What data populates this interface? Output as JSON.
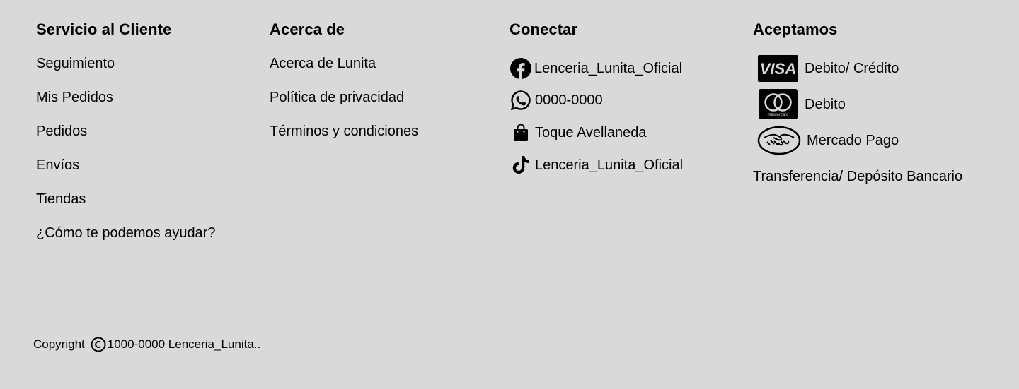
{
  "service": {
    "title": "Servicio al Cliente",
    "links": [
      "Seguimiento",
      "Mis Pedidos",
      "Pedidos",
      "Envíos",
      "Tiendas",
      "¿Cómo te podemos ayudar?"
    ]
  },
  "about": {
    "title": "Acerca de",
    "links": [
      "Acerca de Lunita",
      "Política de privacidad",
      "Términos y condiciones"
    ]
  },
  "connect": {
    "title": "Conectar",
    "items": [
      {
        "icon": "facebook-icon",
        "text": "Lenceria_Lunita_Oficial"
      },
      {
        "icon": "whatsapp-icon",
        "text": "0000-0000"
      },
      {
        "icon": "shopping-bag-icon",
        "text": "Toque Avellaneda"
      },
      {
        "icon": "tiktok-icon",
        "text": "Lenceria_Lunita_Oficial"
      }
    ]
  },
  "accept": {
    "title": "Aceptamos",
    "items": [
      {
        "icon": "visa-icon",
        "text": "Debito/ Crédito",
        "logo_text": "VISA"
      },
      {
        "icon": "mastercard-icon",
        "text": "Debito",
        "logo_text": "mastercard"
      },
      {
        "icon": "mercado-pago-icon",
        "text": "Mercado Pago"
      }
    ],
    "transfer": "Transferencia/ Depósito Bancario"
  },
  "footer": {
    "copyright_label": "Copyright",
    "copyright_text": "1000-0000 Lenceria_Lunita.."
  },
  "colors": {
    "background": "#d9d9d9",
    "text": "#000000"
  }
}
